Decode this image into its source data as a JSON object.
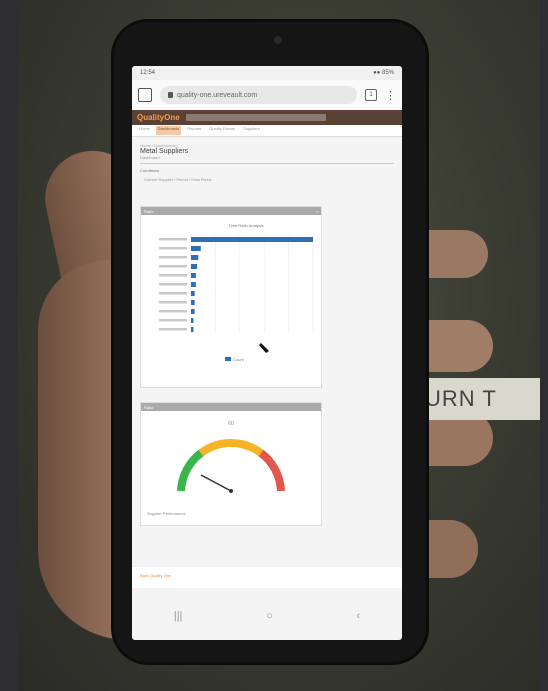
{
  "background_label": "URN T",
  "browser": {
    "status_time": "12:54",
    "status_battery": "●● 85%",
    "url": "quality-one.ureveault.com",
    "tab_count": "1",
    "menu": "⋮"
  },
  "app": {
    "logo": "QualityOne",
    "nav_tabs": [
      "Home",
      "Dashboards",
      "Reports",
      "Quality Events",
      "Suppliers"
    ],
    "breadcrumb": "Home / Dashboards",
    "page_title": "Metal Suppliers",
    "page_subtitle": "Dashboard",
    "filter_label": "Conditions",
    "filter_sub": "Current Supplier / Period / Data Fields"
  },
  "bar_panel": {
    "title": "Ratio",
    "chart_title": "Time Ratio Analysis",
    "legend": "Count"
  },
  "gauge_panel": {
    "title": "Ratio",
    "caption": "Supplier Performance",
    "top_label": "60"
  },
  "footer": {
    "text": "Back   Quality One"
  },
  "navkeys": {
    "recent": "|||",
    "home": "○",
    "back": "‹"
  },
  "colors": {
    "header": "#5a4136",
    "accent": "#f39a4c",
    "bar": "#2f6fb3",
    "gauge_green": "#3ab54a",
    "gauge_yellow": "#f5b325",
    "gauge_red": "#e2574c"
  },
  "chart_data": {
    "type": "bar",
    "orientation": "horizontal",
    "categories": [
      "C1",
      "C2",
      "C3",
      "C4",
      "C5",
      "C6",
      "C7",
      "C8",
      "C9",
      "C10",
      "C11"
    ],
    "values": [
      100,
      8,
      6,
      5,
      4,
      4,
      3,
      3,
      3,
      2,
      2
    ],
    "xlim": [
      0,
      100
    ]
  }
}
